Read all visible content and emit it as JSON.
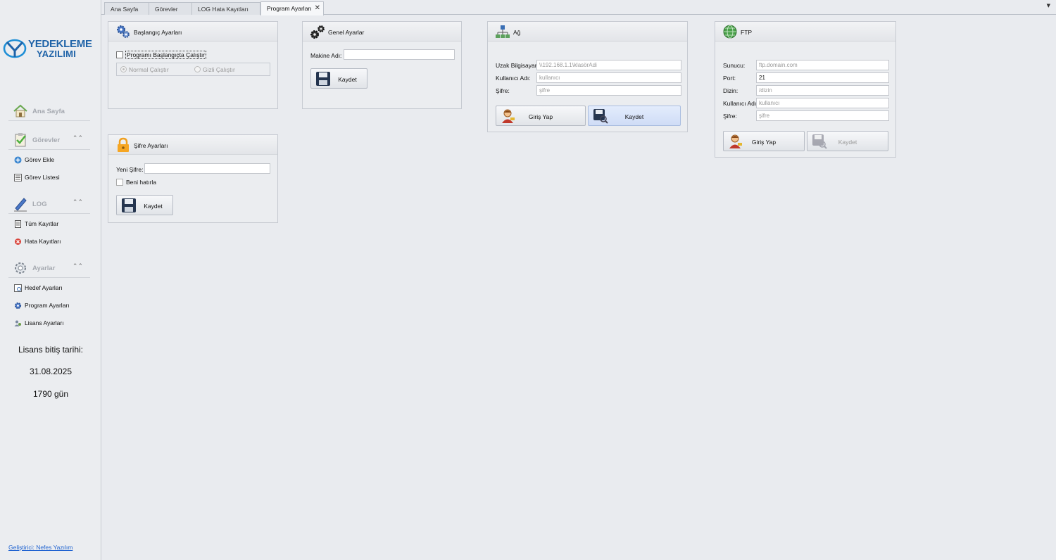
{
  "logo": {
    "line1": "YEDEKLEME",
    "line2": "YAZILIMI"
  },
  "sidebar": {
    "home_label": "Ana Sayfa",
    "groups": [
      {
        "label": "Görevler",
        "collapse": "⌃⌃",
        "items": [
          {
            "label": "Görev Ekle"
          },
          {
            "label": "Görev Listesi"
          }
        ]
      },
      {
        "label": "LOG",
        "collapse": "⌃⌃",
        "items": [
          {
            "label": "Tüm Kayıtlar"
          },
          {
            "label": "Hata Kayıtları"
          }
        ]
      },
      {
        "label": "Ayarlar",
        "collapse": "⌃⌃",
        "items": [
          {
            "label": "Hedef Ayarları"
          },
          {
            "label": "Program Ayarları"
          },
          {
            "label": "Lisans Ayarları"
          }
        ]
      }
    ],
    "license_title": "Lisans bitiş tarihi:",
    "license_date": "31.08.2025",
    "license_days": "1790 gün",
    "developer_link": "Geliştirici: Nefes Yazılım"
  },
  "tabs": [
    {
      "label": "Ana Sayfa"
    },
    {
      "label": "Görevler"
    },
    {
      "label": "LOG Hata Kayıtları"
    },
    {
      "label": "Program Ayarları",
      "close": "✕"
    }
  ],
  "tab_menu": "▼",
  "startup": {
    "title": "Başlangıç Ayarları",
    "run_at_startup": "Programı Başlangıçta Çalıştır",
    "normal": "Normal Çalıştır",
    "hidden": "Gizli Çalıştır"
  },
  "password": {
    "title": "Şifre Ayarları",
    "new_password_label": "Yeni Şifre:",
    "new_password_value": "",
    "remember": "Beni hatırla",
    "save": "Kaydet"
  },
  "general": {
    "title": "Genel Ayarlar",
    "machine_label": "Makine Adı:",
    "machine_value": "",
    "save": "Kaydet"
  },
  "network": {
    "title": "Ağ",
    "remote_label": "Uzak Bilgisayar:",
    "remote_placeholder": "\\\\192.168.1.1\\klasörAdi",
    "user_label": "Kullanıcı Adı:",
    "user_placeholder": "kullanıcı",
    "pass_label": "Şifre:",
    "pass_placeholder": "şifre",
    "login": "Giriş Yap",
    "save": "Kaydet"
  },
  "ftp": {
    "title": "FTP",
    "server_label": "Sunucu:",
    "server_placeholder": "ftp.domain.com",
    "port_label": "Port:",
    "port_value": "21",
    "dir_label": "Dizin:",
    "dir_placeholder": "/dizin",
    "user_label": "Kullanıcı Adı:",
    "user_placeholder": "kullanıcı",
    "pass_label": "Şifre:",
    "pass_placeholder": "şifre",
    "login": "Giriş Yap",
    "save": "Kaydet"
  },
  "colors": {
    "brand": "#1f63a8",
    "link": "#1f63d1",
    "sidebar_bg": "#ebedf0"
  }
}
